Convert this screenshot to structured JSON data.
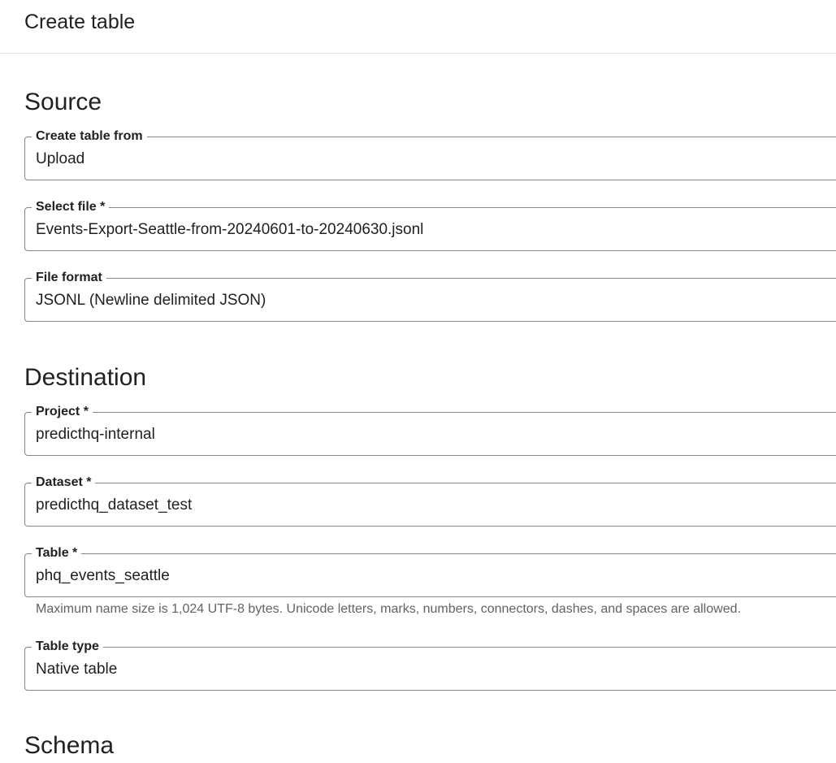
{
  "header": {
    "title": "Create table"
  },
  "source": {
    "title": "Source",
    "create_table_from": {
      "label": "Create table from",
      "value": "Upload"
    },
    "select_file": {
      "label": "Select file *",
      "value": "Events-Export-Seattle-from-20240601-to-20240630.jsonl"
    },
    "file_format": {
      "label": "File format",
      "value": "JSONL (Newline delimited JSON)"
    }
  },
  "destination": {
    "title": "Destination",
    "project": {
      "label": "Project *",
      "value": "predicthq-internal"
    },
    "dataset": {
      "label": "Dataset *",
      "value": "predicthq_dataset_test"
    },
    "table": {
      "label": "Table *",
      "value": "phq_events_seattle",
      "hint": "Maximum name size is 1,024 UTF-8 bytes. Unicode letters, marks, numbers, connectors, dashes, and spaces are allowed."
    },
    "table_type": {
      "label": "Table type",
      "value": "Native table"
    }
  },
  "schema": {
    "title": "Schema"
  }
}
